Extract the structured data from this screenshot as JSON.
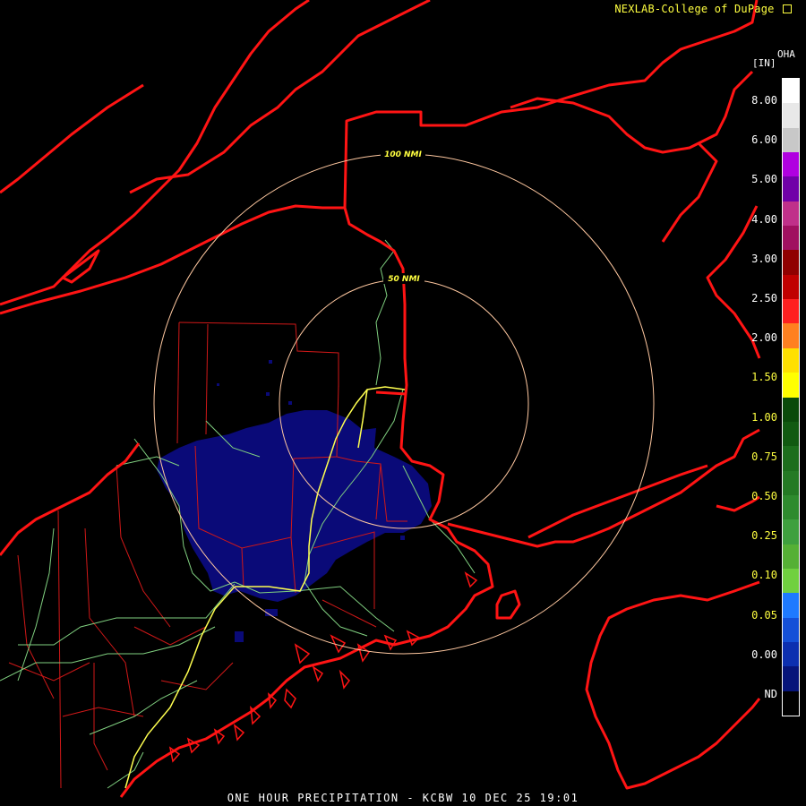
{
  "credit": "NEXLAB-College of DuPage",
  "credit_icon": "external-link-icon",
  "product_code": "OHA",
  "unit": "[IN]",
  "footer": "ONE HOUR PRECIPITATION - KCBW 10 DEC 25 19:01",
  "rings": [
    {
      "label": "100 NMI"
    },
    {
      "label": "50 NMI"
    }
  ],
  "legend": {
    "labels": [
      "8.00",
      "6.00",
      "5.00",
      "4.00",
      "3.00",
      "2.50",
      "2.00",
      "1.50",
      "1.00",
      "0.75",
      "0.50",
      "0.25",
      "0.10",
      "0.05",
      "0.00",
      "ND"
    ],
    "colors": [
      "#ffffff",
      "#e8e8e8",
      "#c8c8c8",
      "#b000e0",
      "#7000a8",
      "#c0308a",
      "#a01060",
      "#900000",
      "#c00000",
      "#ff2020",
      "#ff8020",
      "#ffe000",
      "#ffff00",
      "#0a4a0a",
      "#115a11",
      "#1c6e1c",
      "#247a24",
      "#2e8b2e",
      "#3ea03e",
      "#55b035",
      "#70d040",
      "#1e7aff",
      "#1450d8",
      "#0c2fb0",
      "#06147a",
      "#000000"
    ]
  },
  "colors": {
    "border": "#ff1414",
    "county": "#d01818",
    "road": "#80d080",
    "interstate": "#ffff50",
    "ring": "#ffc8a0",
    "precip": "#0a0a78"
  }
}
